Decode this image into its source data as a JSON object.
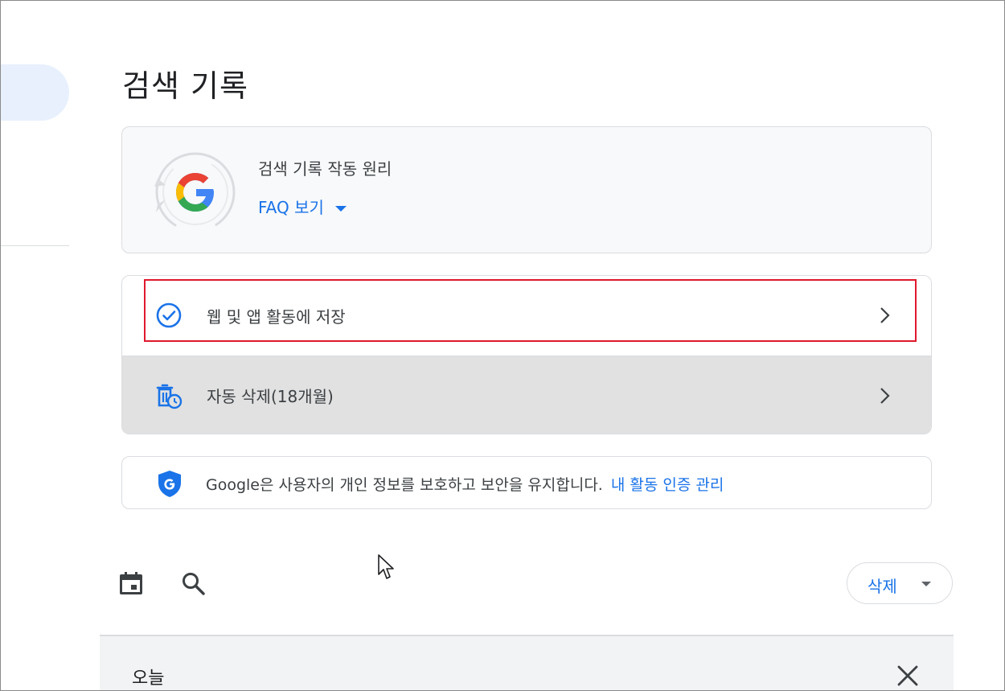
{
  "page": {
    "title": "검색 기록"
  },
  "faq": {
    "title": "검색 기록 작동 원리",
    "link_label": "FAQ 보기"
  },
  "settings": [
    {
      "label": "웹 및 앱 활동에 저장",
      "icon": "check-circle-icon"
    },
    {
      "label": "자동 삭제(18개월)",
      "icon": "auto-delete-icon"
    }
  ],
  "privacy": {
    "text": "Google은 사용자의 개인 정보를 보호하고 보안을 유지합니다.",
    "link": "내 활동 인증 관리"
  },
  "toolbar": {
    "delete_label": "삭제"
  },
  "history": {
    "section_label": "오늘"
  },
  "colors": {
    "accent": "#1a73e8",
    "highlight_border": "#e0182d",
    "selected_row_bg": "#e1e1e1",
    "nav_pill_bg": "#e8f0fe"
  }
}
